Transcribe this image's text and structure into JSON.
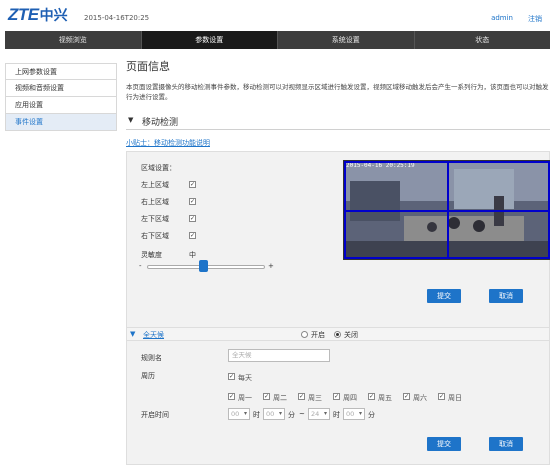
{
  "header": {
    "logo_en": "ZTE",
    "logo_cn": "中兴",
    "datetime": "2015-04-16T20:25",
    "user": "admin",
    "logout": "注销"
  },
  "nav": {
    "tabs": [
      "视频浏览",
      "参数设置",
      "系统设置",
      "状态"
    ],
    "active_index": 1
  },
  "sidebar": {
    "items": [
      "上网参数设置",
      "视频和音频设置",
      "应用设置",
      "事件设置"
    ],
    "active_index": 3
  },
  "page": {
    "title": "页面信息",
    "description": "本页面设置摄像头的移动检测事件参数，移动检测可以对视频显示区域进行触发设置，视频区域移动触发后会产生一系列行为，该页面也可以对触发行为进行设置。"
  },
  "motion": {
    "section_title": "移动检测",
    "tip_link": "小贴士：移动检测功能说明",
    "region_label": "区域设置：",
    "regions": [
      {
        "label": "左上区域",
        "checked": true
      },
      {
        "label": "右上区域",
        "checked": true
      },
      {
        "label": "左下区域",
        "checked": true
      },
      {
        "label": "右下区域",
        "checked": true
      }
    ],
    "sensitivity_label": "灵敏度",
    "sensitivity_value": "中",
    "slider_minus": "-",
    "slider_plus": "+",
    "sensitivity_level": 0.5,
    "camera_timestamp": "2015-04-16 20:25:19",
    "submit": "提交",
    "cancel": "取消"
  },
  "schedule": {
    "name": "全天候",
    "radio_on": "开启",
    "radio_off": "关闭",
    "selected": "关闭",
    "rule_name_label": "规则名",
    "rule_name_placeholder": "全天候",
    "repeat_label": "周历",
    "everyday_label": "每天",
    "everyday_checked": true,
    "days": [
      "周一",
      "周二",
      "周三",
      "周四",
      "周五",
      "周六",
      "周日"
    ],
    "time_label": "开启时间",
    "start_hour": "00",
    "start_min": "00",
    "end_hour": "24",
    "end_min": "00",
    "hour_unit": "时",
    "min_unit": "分",
    "range_sep": "~",
    "submit": "提交",
    "cancel": "取消"
  },
  "colors": {
    "accent": "#1e74c9",
    "grid": "#0000cc"
  }
}
